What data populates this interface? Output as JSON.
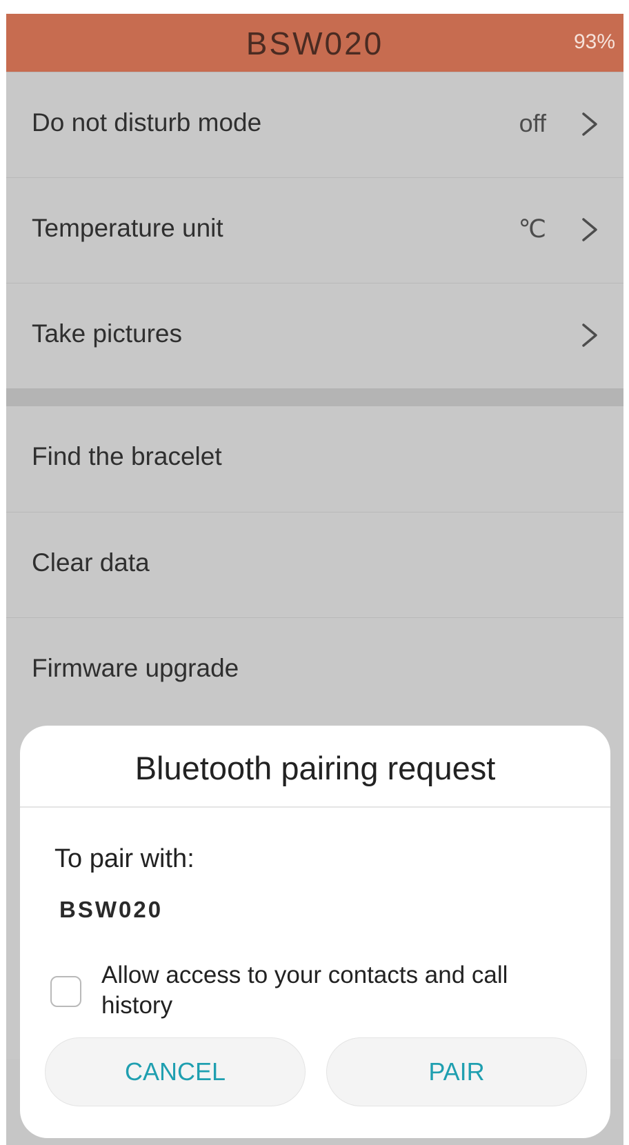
{
  "header": {
    "title": "BSW020",
    "battery": "93%"
  },
  "settings": {
    "do_not_disturb": {
      "label": "Do not disturb mode",
      "value": "off"
    },
    "temperature_unit": {
      "label": "Temperature unit",
      "value": "℃"
    },
    "take_pictures": {
      "label": "Take pictures"
    },
    "find_bracelet": {
      "label": "Find the bracelet"
    },
    "clear_data": {
      "label": "Clear data"
    },
    "firmware_upgrade": {
      "label": "Firmware upgrade"
    }
  },
  "dialog": {
    "title": "Bluetooth pairing request",
    "pair_with_label": "To pair with:",
    "device_name": "BSW020",
    "checkbox_label": "Allow access to your contacts and call history",
    "checkbox_checked": false,
    "cancel_label": "CANCEL",
    "pair_label": "PAIR"
  },
  "icons": {
    "row_chevron": "chevron-right-icon"
  },
  "colors": {
    "header_background": "#c76c50",
    "dialog_button_text": "#1f9fb0",
    "dimmed_background": "#c8c8c8"
  }
}
